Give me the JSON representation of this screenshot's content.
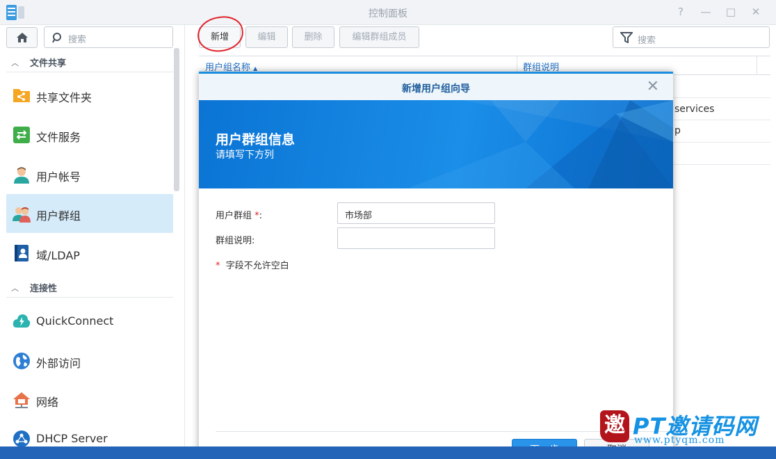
{
  "window": {
    "title": "控制面板",
    "controls": [
      "?",
      "—",
      "□",
      "✕"
    ]
  },
  "sidebar": {
    "search_placeholder": "搜索",
    "sections": [
      {
        "label": "文件共享"
      },
      {
        "label": "连接性"
      }
    ],
    "items": [
      {
        "label": "共享文件夹",
        "icon": "shared-folder-icon"
      },
      {
        "label": "文件服务",
        "icon": "file-service-icon"
      },
      {
        "label": "用户帐号",
        "icon": "user-icon"
      },
      {
        "label": "用户群组",
        "icon": "user-group-icon",
        "active": true
      },
      {
        "label": "域/LDAP",
        "icon": "domain-ldap-icon"
      },
      {
        "label": "QuickConnect",
        "icon": "quickconnect-icon"
      },
      {
        "label": "外部访问",
        "icon": "external-access-icon"
      },
      {
        "label": "网络",
        "icon": "network-icon"
      },
      {
        "label": "DHCP Server",
        "icon": "dhcp-server-icon"
      }
    ]
  },
  "toolbar": {
    "create_label": "新增",
    "edit_label": "编辑",
    "delete_label": "删除",
    "edit_members_label": "编辑群组成员",
    "search_placeholder": "搜索"
  },
  "table": {
    "columns": [
      "用户组名称",
      "群组说明"
    ],
    "visible_desc_fragments": [
      "services",
      "p"
    ]
  },
  "dialog": {
    "title": "新增用户组向导",
    "close_glyph": "✕",
    "banner_title": "用户群组信息",
    "banner_subtitle": "请填写下方列",
    "fields": {
      "group_label": "用户群组",
      "group_required": "*",
      "group_colon": ":",
      "group_value": "市场部",
      "desc_label": "群组说明:",
      "desc_value": ""
    },
    "required_note_mark": "*",
    "required_note": "字段不允许空白",
    "next_label": "下一步",
    "cancel_label": "取消"
  },
  "watermark": {
    "seal_char": "邀",
    "brand": "PT邀请码网",
    "url": "www.ptyqm.com"
  },
  "colors": {
    "accent": "#1a8fe0",
    "active_nav": "#d6ebfa",
    "annotation": "#e0222a",
    "taskbar": "#2363b8"
  }
}
